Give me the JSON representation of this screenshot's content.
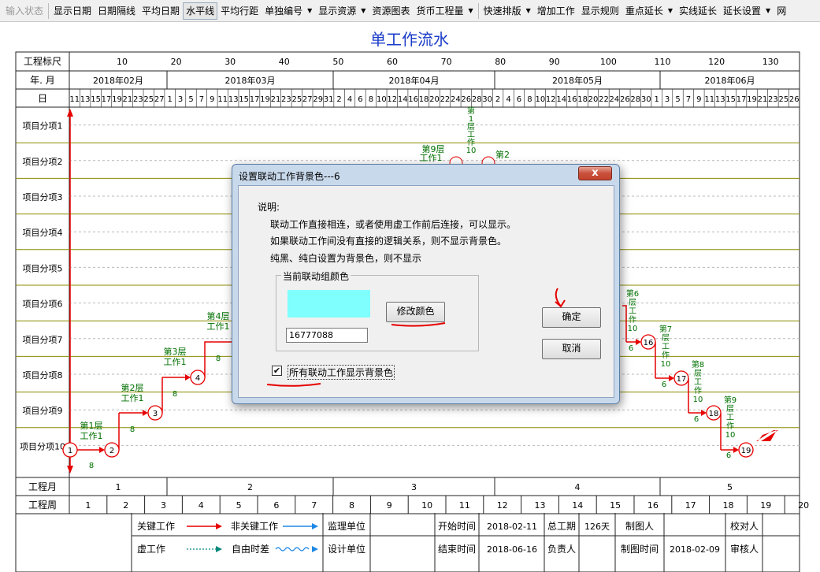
{
  "toolbar": {
    "items": [
      {
        "label": "输入状态",
        "disabled": true,
        "dropdown": false,
        "pressed": false
      },
      {
        "label": "显示日期",
        "disabled": false,
        "dropdown": false,
        "pressed": false
      },
      {
        "label": "日期隔线",
        "disabled": false,
        "dropdown": false,
        "pressed": false
      },
      {
        "label": "平均日期",
        "disabled": false,
        "dropdown": false,
        "pressed": false
      },
      {
        "label": "水平线",
        "disabled": false,
        "dropdown": false,
        "pressed": true
      },
      {
        "label": "平均行距",
        "disabled": false,
        "dropdown": false,
        "pressed": false
      },
      {
        "label": "单独编号",
        "disabled": false,
        "dropdown": true,
        "pressed": false
      },
      {
        "label": "显示资源",
        "disabled": false,
        "dropdown": true,
        "pressed": false
      },
      {
        "label": "资源图表",
        "disabled": false,
        "dropdown": false,
        "pressed": false
      },
      {
        "label": "货币工程量",
        "disabled": false,
        "dropdown": true,
        "pressed": false
      },
      {
        "label": "快速排版",
        "disabled": false,
        "dropdown": true,
        "pressed": false
      },
      {
        "label": "增加工作",
        "disabled": false,
        "dropdown": false,
        "pressed": false
      },
      {
        "label": "显示规则",
        "disabled": false,
        "dropdown": false,
        "pressed": false
      },
      {
        "label": "重点延长",
        "disabled": false,
        "dropdown": true,
        "pressed": false
      },
      {
        "label": "实线延长",
        "disabled": false,
        "dropdown": false,
        "pressed": false
      },
      {
        "label": "延长设置",
        "disabled": false,
        "dropdown": true,
        "pressed": false
      },
      {
        "label": "网",
        "disabled": false,
        "dropdown": false,
        "pressed": false
      }
    ]
  },
  "chart": {
    "title": "单工作流水",
    "ruler_label": "工程标尺",
    "ruler_ticks": [
      "10",
      "20",
      "30",
      "40",
      "50",
      "60",
      "70",
      "80",
      "90",
      "100",
      "110",
      "120",
      "130"
    ],
    "month_label": "年. 月",
    "months": [
      "2018年02月",
      "2018年03月",
      "2018年04月",
      "2018年05月",
      "2018年06月"
    ],
    "day_label": "日",
    "days": [
      "11",
      "13",
      "15",
      "17",
      "19",
      "21",
      "23",
      "25",
      "27",
      "1",
      "3",
      "5",
      "7",
      "9",
      "11",
      "13",
      "15",
      "17",
      "19",
      "21",
      "23",
      "25",
      "27",
      "29",
      "31",
      "2",
      "4",
      "6",
      "8",
      "10",
      "12",
      "14",
      "16",
      "18",
      "20",
      "22",
      "24",
      "26",
      "28",
      "30",
      "2",
      "4",
      "6",
      "8",
      "10",
      "12",
      "14",
      "16",
      "18",
      "20",
      "22",
      "24",
      "26",
      "28",
      "30",
      "1",
      "3",
      "5",
      "7",
      "9",
      "11",
      "13",
      "15",
      "17",
      "19",
      "21",
      "23",
      "25",
      "26"
    ],
    "rows": [
      "项目分项1",
      "项目分项2",
      "项目分项3",
      "项目分项4",
      "项目分项5",
      "项目分项6",
      "项目分项7",
      "项目分项8",
      "项目分项9",
      "项目分项10"
    ],
    "project_month_label": "工程月",
    "project_months": [
      "1",
      "2",
      "3",
      "4",
      "5"
    ],
    "project_week_label": "工程周",
    "project_weeks": [
      "1",
      "2",
      "3",
      "4",
      "5",
      "6",
      "7",
      "8",
      "9",
      "10",
      "11",
      "12",
      "13",
      "14",
      "15",
      "16",
      "17",
      "18",
      "19",
      "20"
    ],
    "nodes": [
      "1",
      "2",
      "3",
      "4",
      "16",
      "17",
      "18",
      "19"
    ],
    "task_labels_left": [
      {
        "label": "第1层工作1",
        "duration": "8"
      },
      {
        "label": "第2层工作1",
        "duration": "8"
      },
      {
        "label": "第3层工作1",
        "duration": "8"
      },
      {
        "label": "第4层工作1",
        "duration": "8"
      }
    ],
    "task_labels_right": [
      {
        "label": "第6层工作10",
        "duration": "6"
      },
      {
        "label": "第7层工作10",
        "duration": "6"
      },
      {
        "label": "第8层工作10",
        "duration": "6"
      },
      {
        "label": "第9层工作10",
        "duration": "6"
      }
    ],
    "task_label_top": {
      "label": "第1层工作10"
    },
    "task_label_mid": {
      "label": "第9层工作1"
    },
    "task_label_mid2": {
      "label": "第2"
    },
    "colors": {
      "grid": "#8b8b00",
      "critical": "#e60000",
      "label": "#007000",
      "title": "#1b3cc8",
      "node": "#e60000"
    }
  },
  "legend": {
    "critical": "关键工作",
    "noncritical": "非关键工作",
    "virtual": "虚工作",
    "free_float": "自由时差",
    "supervisor": "监理单位",
    "designer": "设计单位",
    "start_time_label": "开始时间",
    "start_time": "2018-02-11",
    "end_time_label": "结束时间",
    "end_time": "2018-06-16",
    "total_duration_label": "总工期",
    "total_duration": "126天",
    "owner_label": "负责人",
    "drawer_label": "制图人",
    "draw_time_label": "制图时间",
    "draw_time": "2018-02-09",
    "checker_label": "校对人",
    "reviewer_label": "审核人"
  },
  "dialog": {
    "title": "设置联动工作背景色---6",
    "close_glyph": "x",
    "desc_heading": "说明:",
    "desc_lines": [
      "联动工作直接相连，或者使用虚工作前后连接，可以显示。",
      "如果联动工作间没有直接的逻辑关系，则不显示背景色。",
      "纯黑、纯白设置为背景色，则不显示"
    ],
    "group_label": "当前联动组颜色",
    "swatch_color": "#80ffff",
    "color_value": "16777088",
    "change_color_label": "修改颜色",
    "ok_label": "确定",
    "cancel_label": "取消",
    "checkbox_label": "所有联动工作显示背景色",
    "checkbox_checked": true,
    "checkbox_glyph": "✔"
  }
}
